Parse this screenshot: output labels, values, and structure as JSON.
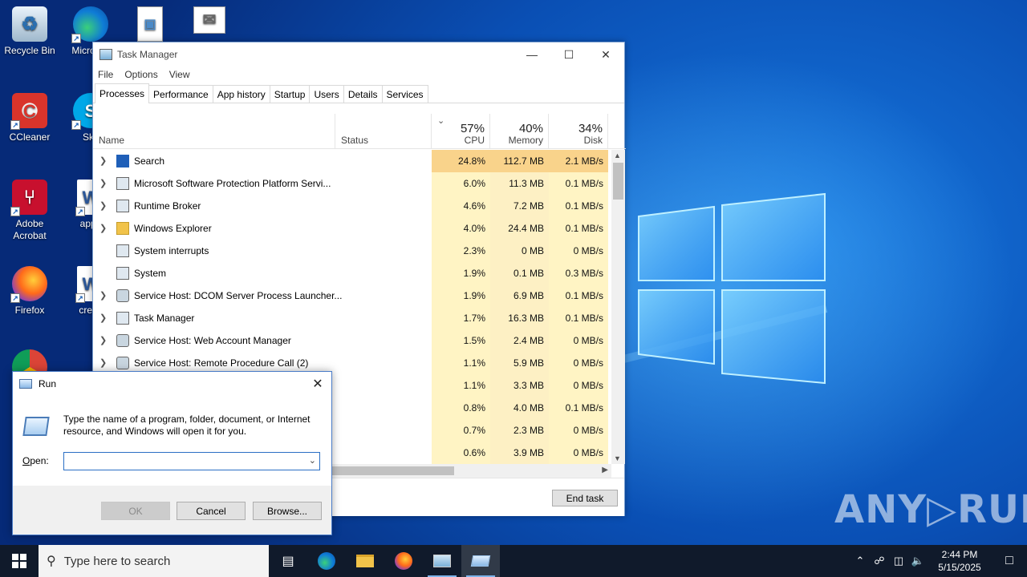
{
  "desktop": {
    "icons": [
      {
        "label": "Recycle Bin",
        "icon": "recycle-bin-icon"
      },
      {
        "label": "Micro Ed",
        "icon": "edge-icon"
      },
      {
        "label": "CCleaner",
        "icon": "ccleaner-icon"
      },
      {
        "label": "Sky",
        "icon": "skype-icon"
      },
      {
        "label": "Adobe Acrobat",
        "icon": "acrobat-icon"
      },
      {
        "label": "appe",
        "icon": "word-doc-icon"
      },
      {
        "label": "Firefox",
        "icon": "firefox-icon"
      },
      {
        "label": "creati",
        "icon": "word-doc-icon"
      },
      {
        "label": "",
        "icon": "chrome-icon"
      },
      {
        "label": "",
        "icon": "image-file-icon"
      },
      {
        "label": "",
        "icon": "mail-file-icon"
      }
    ],
    "watermark": "ANY▷RUN"
  },
  "task_manager": {
    "title": "Task Manager",
    "menu": [
      "File",
      "Options",
      "View"
    ],
    "tabs": [
      "Processes",
      "Performance",
      "App history",
      "Startup",
      "Users",
      "Details",
      "Services"
    ],
    "active_tab": "Processes",
    "columns": {
      "name": "Name",
      "status": "Status",
      "cpu": {
        "label": "CPU",
        "pct": "57%"
      },
      "memory": {
        "label": "Memory",
        "pct": "40%"
      },
      "disk": {
        "label": "Disk",
        "pct": "34%"
      }
    },
    "rows": [
      {
        "name": "Search",
        "cpu": "24.8%",
        "mem": "112.7 MB",
        "disk": "2.1 MB/s",
        "icon": "search-icon",
        "expandable": true
      },
      {
        "name": "Microsoft Software Protection Platform Servi...",
        "cpu": "6.0%",
        "mem": "11.3 MB",
        "disk": "0.1 MB/s",
        "icon": "service-window-icon",
        "expandable": true
      },
      {
        "name": "Runtime Broker",
        "cpu": "4.6%",
        "mem": "7.2 MB",
        "disk": "0.1 MB/s",
        "icon": "service-window-icon",
        "expandable": true
      },
      {
        "name": "Windows Explorer",
        "cpu": "4.0%",
        "mem": "24.4 MB",
        "disk": "0.1 MB/s",
        "icon": "folder-icon",
        "expandable": true
      },
      {
        "name": "System interrupts",
        "cpu": "2.3%",
        "mem": "0 MB",
        "disk": "0 MB/s",
        "icon": "service-window-icon",
        "expandable": false
      },
      {
        "name": "System",
        "cpu": "1.9%",
        "mem": "0.1 MB",
        "disk": "0.3 MB/s",
        "icon": "service-window-icon",
        "expandable": false
      },
      {
        "name": "Service Host: DCOM Server Process Launcher...",
        "cpu": "1.9%",
        "mem": "6.9 MB",
        "disk": "0.1 MB/s",
        "icon": "gear-icon",
        "expandable": true
      },
      {
        "name": "Task Manager",
        "cpu": "1.7%",
        "mem": "16.3 MB",
        "disk": "0.1 MB/s",
        "icon": "task-manager-icon",
        "expandable": true
      },
      {
        "name": "Service Host: Web Account Manager",
        "cpu": "1.5%",
        "mem": "2.4 MB",
        "disk": "0 MB/s",
        "icon": "gear-icon",
        "expandable": true
      },
      {
        "name": "Service Host: Remote Procedure Call (2)",
        "cpu": "1.1%",
        "mem": "5.9 MB",
        "disk": "0 MB/s",
        "icon": "gear-icon",
        "expandable": true
      },
      {
        "name": "",
        "cpu": "1.1%",
        "mem": "3.3 MB",
        "disk": "0 MB/s",
        "icon": "",
        "expandable": false
      },
      {
        "name": "",
        "cpu": "0.8%",
        "mem": "4.0 MB",
        "disk": "0.1 MB/s",
        "icon": "",
        "expandable": false
      },
      {
        "name": "",
        "cpu": "0.7%",
        "mem": "2.3 MB",
        "disk": "0 MB/s",
        "icon": "",
        "expandable": false
      },
      {
        "name": "",
        "cpu": "0.6%",
        "mem": "3.9 MB",
        "disk": "0 MB/s",
        "icon": "",
        "expandable": false
      }
    ],
    "end_task_label": "End task",
    "heat_colors": {
      "high": "#f9d38b",
      "mid": "#fdf0c4",
      "low": "#fff4c4"
    }
  },
  "run_dialog": {
    "title": "Run",
    "description": "Type the name of a program, folder, document, or Internet resource, and Windows will open it for you.",
    "open_label_prefix": "",
    "open_label_underlined": "O",
    "open_label_rest": "pen:",
    "open_value": "",
    "ok_label": "OK",
    "cancel_label": "Cancel",
    "browse_label": "Browse..."
  },
  "taskbar": {
    "search_placeholder": "Type here to search",
    "time": "2:44 PM",
    "date": "5/15/2025",
    "apps": [
      "task-view-icon",
      "edge-icon",
      "file-explorer-icon",
      "firefox-icon",
      "task-manager-icon",
      "run-icon"
    ]
  }
}
